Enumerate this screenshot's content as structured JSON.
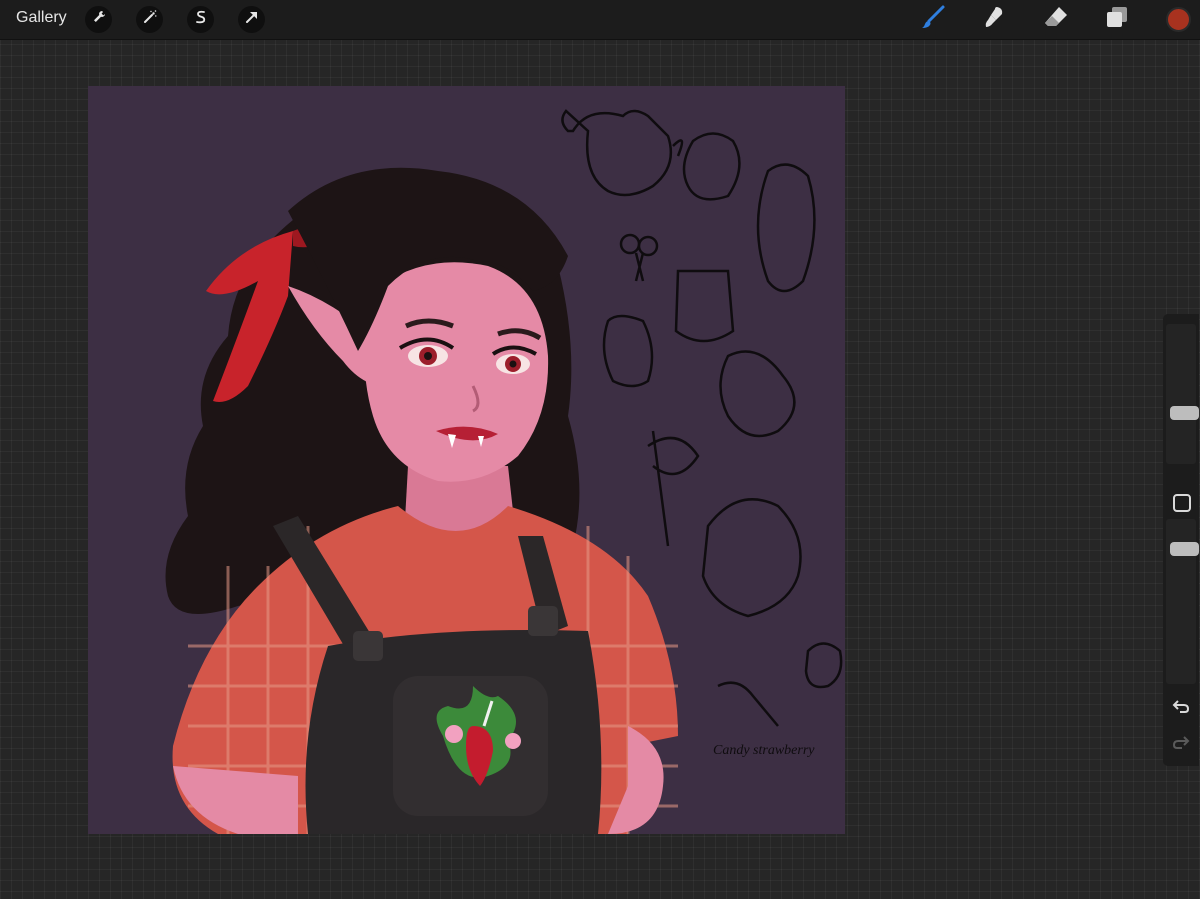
{
  "topbar": {
    "gallery_label": "Gallery",
    "left_tools": [
      "wrench-icon",
      "magic-wand-icon",
      "selection-icon",
      "transform-arrow-icon"
    ],
    "right_tools": [
      "brush-icon",
      "smudge-icon",
      "eraser-icon",
      "layers-icon"
    ],
    "active_tool": "brush-icon",
    "accent_color": "#2f7fe0",
    "current_color": "#a8321f"
  },
  "sidebar": {
    "brush_size_level": 0.35,
    "opacity_level": 0.15,
    "icons": [
      "modifier-square-icon",
      "undo-icon",
      "redo-icon"
    ]
  },
  "canvas": {
    "background_color": "#3d2f44",
    "signature_text": "Candy strawberry"
  }
}
